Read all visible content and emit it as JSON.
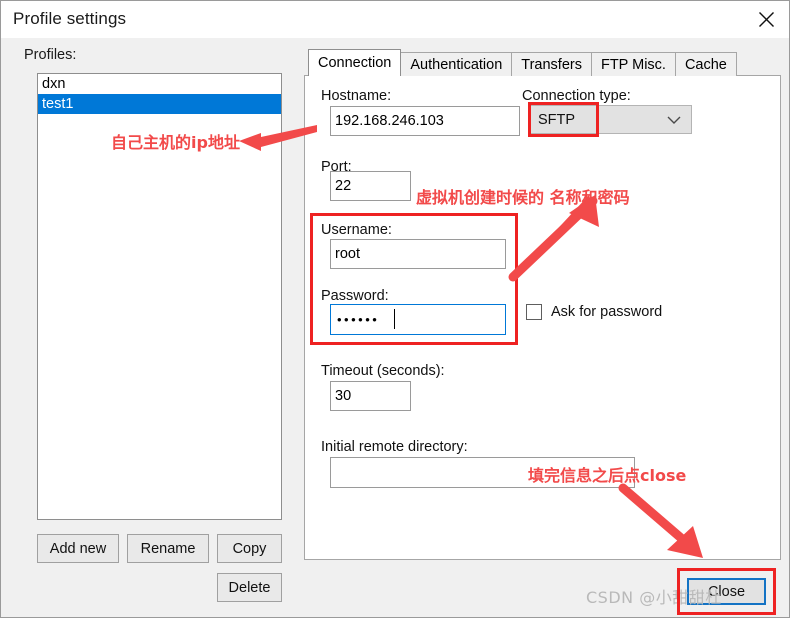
{
  "window": {
    "title": "Profile settings",
    "close_icon": "close-x-icon"
  },
  "left_panel": {
    "profiles_label": "Profiles:",
    "profiles": [
      {
        "name": "dxn",
        "selected": false
      },
      {
        "name": "test1",
        "selected": true
      }
    ],
    "buttons": {
      "add_new": "Add new",
      "rename": "Rename",
      "copy": "Copy",
      "delete": "Delete"
    }
  },
  "tabs": [
    {
      "label": "Connection",
      "active": true
    },
    {
      "label": "Authentication",
      "active": false
    },
    {
      "label": "Transfers",
      "active": false
    },
    {
      "label": "FTP Misc.",
      "active": false
    },
    {
      "label": "Cache",
      "active": false
    }
  ],
  "connection_tab": {
    "hostname": {
      "label": "Hostname:",
      "value": "192.168.246.103"
    },
    "connection_type": {
      "label": "Connection type:",
      "value": "SFTP",
      "arrow_icon": "chevron-down-icon"
    },
    "port": {
      "label": "Port:",
      "value": "22"
    },
    "username": {
      "label": "Username:",
      "value": "root"
    },
    "password": {
      "label": "Password:",
      "value": "••••••",
      "masked_char_count": 6
    },
    "ask_for_password": {
      "label": "Ask for password",
      "checked": false
    },
    "timeout": {
      "label": "Timeout (seconds):",
      "value": "30"
    },
    "initial_remote_directory": {
      "label": "Initial remote directory:",
      "value": ""
    }
  },
  "footer": {
    "close_button": "Close"
  },
  "annotations": {
    "color": "#f24a4a",
    "texts": {
      "ip_hint": "自己主机的ip地址",
      "credentials_hint": "虚拟机创建时候的 名称和密码",
      "close_hint": "填完信息之后点close"
    }
  },
  "watermark": {
    "text": "CSDN @小甜甜杜"
  }
}
